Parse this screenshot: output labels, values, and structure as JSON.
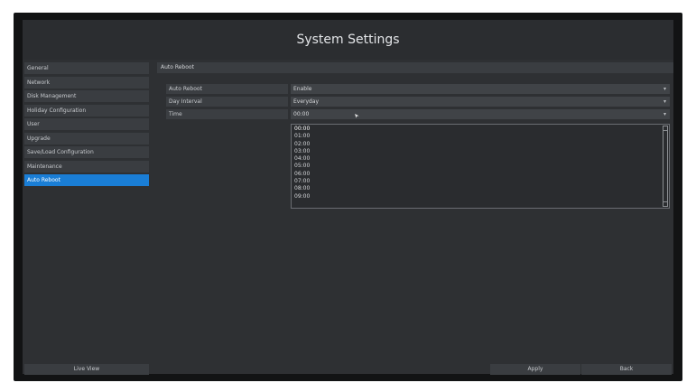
{
  "window": {
    "title": "System Settings"
  },
  "sidebar": {
    "items": [
      {
        "label": "General"
      },
      {
        "label": "Network"
      },
      {
        "label": "Disk Management"
      },
      {
        "label": "Holiday Configuration"
      },
      {
        "label": "User"
      },
      {
        "label": "Upgrade"
      },
      {
        "label": "Save/Load Configuration"
      },
      {
        "label": "Maintenance"
      },
      {
        "label": "Auto Reboot",
        "active": true
      }
    ],
    "live_view_label": "Live View"
  },
  "main": {
    "section_title": "Auto Reboot",
    "form": {
      "auto_reboot": {
        "label": "Auto Reboot",
        "value": "Enable"
      },
      "day_interval": {
        "label": "Day Interval",
        "value": "Everyday"
      },
      "time": {
        "label": "Time",
        "value": "00:00"
      }
    },
    "time_dropdown": {
      "options": [
        "00:00",
        "01:00",
        "02:00",
        "03:00",
        "04:00",
        "05:00",
        "06:00",
        "07:00",
        "08:00",
        "09:00"
      ],
      "selected": "00:00"
    }
  },
  "footer": {
    "apply_label": "Apply",
    "back_label": "Back"
  },
  "colors": {
    "accent": "#1a7ed6",
    "background": "#2e3033",
    "panel": "#3a3d41"
  },
  "icons": {
    "dropdown": "chevron-down-icon",
    "pointer": "mouse-pointer-icon"
  }
}
